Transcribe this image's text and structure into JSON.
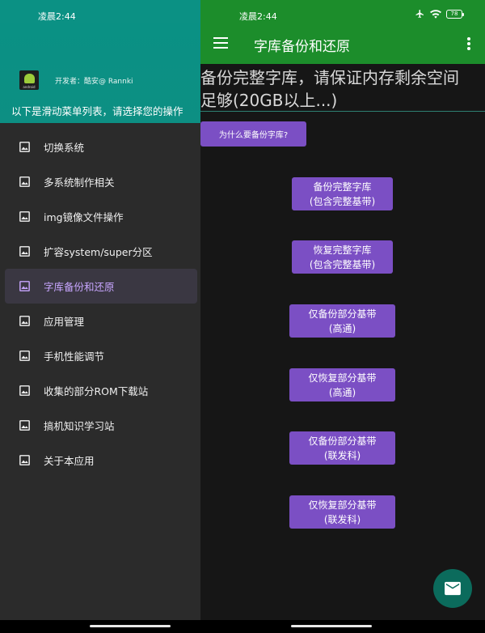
{
  "status_bar": {
    "time_left": "凌晨2:44",
    "time_right": "凌晨2:44",
    "battery": "78"
  },
  "drawer": {
    "developer": "开发者：酷安@ Rannki",
    "logo_text": "android",
    "subtitle": "以下是滑动菜单列表，请选择您的操作",
    "items": [
      {
        "label": "切换系统"
      },
      {
        "label": "多系统制作相关"
      },
      {
        "label": "img镜像文件操作"
      },
      {
        "label": "扩容system/super分区"
      },
      {
        "label": "字库备份和还原"
      },
      {
        "label": "应用管理"
      },
      {
        "label": "手机性能调节"
      },
      {
        "label": "收集的部分ROM下载站"
      },
      {
        "label": "搞机知识学习站"
      },
      {
        "label": "关于本应用"
      }
    ],
    "active_index": 4
  },
  "app_bar": {
    "title": "字库备份和还原"
  },
  "content": {
    "headline_line1": "备份完整字库，请保证内存剩余空间",
    "headline_line2": "足够(20GB以上...)",
    "why_button": "为什么要备份字库?",
    "actions": [
      {
        "line1": "备份完整字库",
        "line2": "(包含完整基带)"
      },
      {
        "line1": "恢复完整字库",
        "line2": "(包含完整基带)"
      },
      {
        "line1": "仅备份部分基带",
        "line2": "(高通)"
      },
      {
        "line1": "仅恢复部分基带",
        "line2": "(高通)"
      },
      {
        "line1": "仅备份部分基带",
        "line2": "(联发科)"
      },
      {
        "line1": "仅恢复部分基带",
        "line2": "(联发科)"
      }
    ]
  },
  "colors": {
    "drawer_header": "#0a9184",
    "app_bar": "#1c8d2b",
    "button": "#7b4fc4",
    "active_item": "#c8a6ff",
    "fab": "#0b6b5c"
  },
  "icons": {
    "menu_item": "image-icon",
    "fab": "mail-icon"
  }
}
